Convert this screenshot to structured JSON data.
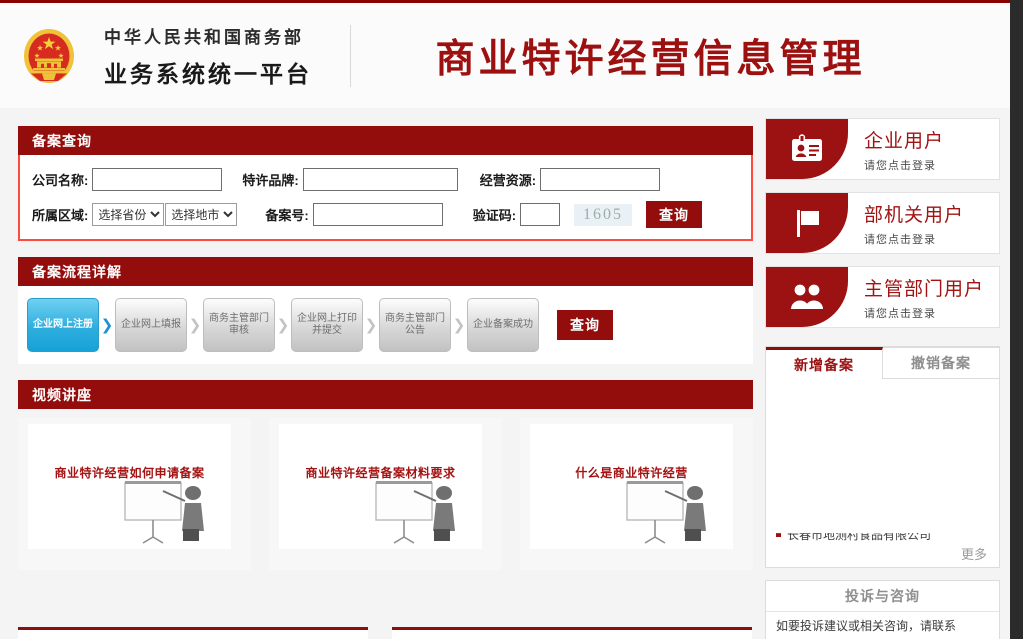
{
  "header": {
    "emblem_alt": "national-emblem",
    "ministry_line1": "中华人民共和国商务部",
    "ministry_line2": "业务系统统一平台",
    "site_title": "商业特许经营信息管理"
  },
  "search_section": {
    "heading": "备案查询",
    "labels": {
      "company": "公司名称:",
      "brand": "特许品牌:",
      "resource": "经营资源:",
      "region": "所属区域:",
      "record_no": "备案号:",
      "captcha": "验证码:"
    },
    "values": {
      "company": "",
      "brand": "",
      "resource": "",
      "record_no": "",
      "captcha": ""
    },
    "selects": {
      "province": "选择省份",
      "city": "选择地市"
    },
    "captcha_code": "1605",
    "submit_label": "查询"
  },
  "flow_section": {
    "heading": "备案流程详解",
    "steps": [
      {
        "label": "企业网上注册",
        "active": true
      },
      {
        "label": "企业网上填报",
        "active": false
      },
      {
        "label": "商务主管部门审核",
        "active": false
      },
      {
        "label": "企业网上打印并提交",
        "active": false
      },
      {
        "label": "商务主管部门公告",
        "active": false
      },
      {
        "label": "企业备案成功",
        "active": false
      }
    ],
    "query_label": "查询"
  },
  "video_section": {
    "heading": "视频讲座",
    "videos": [
      {
        "title": "商业特许经营如何申请备案"
      },
      {
        "title": "商业特许经营备案材料要求"
      },
      {
        "title": "什么是商业特许经营"
      }
    ]
  },
  "logins": [
    {
      "title": "企业用户",
      "subtitle": "请您点击登录",
      "icon": "id-card-icon"
    },
    {
      "title": "部机关用户",
      "subtitle": "请您点击登录",
      "icon": "flag-icon"
    },
    {
      "title": "主管部门用户",
      "subtitle": "请您点击登录",
      "icon": "users-icon"
    }
  ],
  "record_tabs": {
    "tabs": [
      {
        "label": "新增备案",
        "active": true
      },
      {
        "label": "撤销备案",
        "active": false
      }
    ],
    "items": [
      "长春市地测村食品有限公司"
    ],
    "more_label": "更多"
  },
  "complaint": {
    "heading": "投诉与咨询",
    "text": "如要投诉建议或相关咨询，请联系"
  },
  "colors": {
    "brand_red": "#930d0d",
    "title_red": "#9c1010",
    "accent_outline": "#ff4a3d",
    "active_step_blue": "#2eaede",
    "page_bg": "#f4f4f4"
  }
}
